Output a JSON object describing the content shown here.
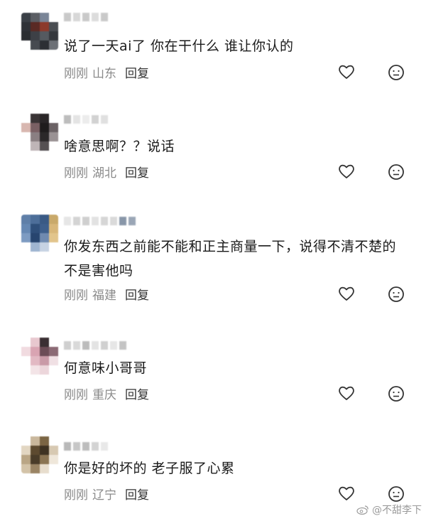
{
  "comments": [
    {
      "text": "说了一天ai了 你在干什么 谁让你认的",
      "time": "刚刚",
      "location": "山东",
      "reply_label": "回复"
    },
    {
      "text": "啥意思啊？？说话",
      "time": "刚刚",
      "location": "湖北",
      "reply_label": "回复"
    },
    {
      "text": "你发东西之前能不能和正主商量一下，说得不清不楚的不是害他吗",
      "time": "刚刚",
      "location": "福建",
      "reply_label": "回复"
    },
    {
      "text": "何意味小哥哥",
      "time": "刚刚",
      "location": "重庆",
      "reply_label": "回复"
    },
    {
      "text": "你是好的坏的 老子服了心累",
      "time": "刚刚",
      "location": "辽宁",
      "reply_label": "回复"
    }
  ],
  "watermark": {
    "text": "@不甜李下"
  },
  "icons": {
    "like": "heart-outline-icon",
    "reaction": "smiley-face-icon",
    "watermark": "weibo-logo-icon"
  },
  "colors": {
    "meta_text": "#8a8a8a",
    "body_text": "#1a1a1a",
    "reply_text": "#333333",
    "icon_stroke": "#333333"
  }
}
